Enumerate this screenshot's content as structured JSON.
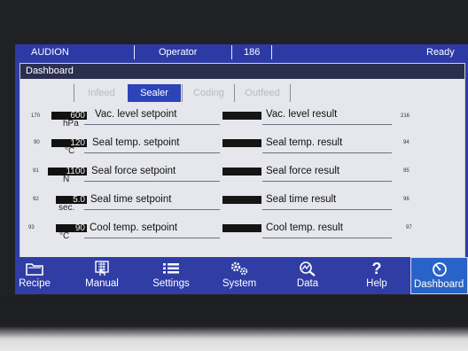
{
  "status": {
    "brand": "AUDION",
    "user": "Operator",
    "code": "186",
    "state": "Ready"
  },
  "panel": {
    "title": "Dashboard"
  },
  "tabs": [
    {
      "label": "Infeed"
    },
    {
      "label": "Sealer"
    },
    {
      "label": "Coding"
    },
    {
      "label": "Outfeed"
    }
  ],
  "rows": [
    {
      "idx": "170",
      "value": "600",
      "unit": "hPa",
      "setpoint": "Vac. level setpoint",
      "result": "Vac. level result",
      "result_idx": "216"
    },
    {
      "idx": "90",
      "value": "120",
      "unit": "°C",
      "setpoint": "Seal temp. setpoint",
      "result": "Seal temp. result",
      "result_idx": "94"
    },
    {
      "idx": "91",
      "value": "1100",
      "unit": "N",
      "setpoint": "Seal force setpoint",
      "result": "Seal force result",
      "result_idx": "95"
    },
    {
      "idx": "92",
      "value": "5.0",
      "unit": "sec.",
      "setpoint": "Seal time setpoint",
      "result": "Seal time result",
      "result_idx": "96"
    },
    {
      "idx": "93",
      "value": "90",
      "unit": "°C",
      "setpoint": "Cool temp. setpoint",
      "result": "Cool temp. result",
      "result_idx": "97"
    }
  ],
  "nav": [
    {
      "label": "Recipe",
      "icon": "folder-icon"
    },
    {
      "label": "Manual",
      "icon": "hand-keypad-icon"
    },
    {
      "label": "Settings",
      "icon": "list-icon"
    },
    {
      "label": "System",
      "icon": "gears-icon"
    },
    {
      "label": "Data",
      "icon": "chart-magnifier-icon"
    },
    {
      "label": "Help",
      "icon": "question-icon"
    },
    {
      "label": "Dashboard",
      "icon": "gauge-icon"
    }
  ],
  "colors": {
    "accent": "#2f3da5",
    "active_tab": "#2d43b8",
    "active_nav": "#2a63c8"
  }
}
